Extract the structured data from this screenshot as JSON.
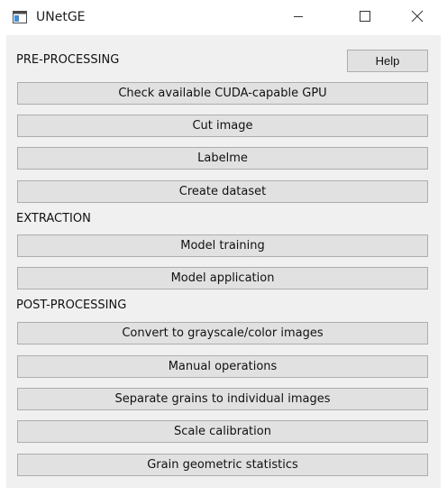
{
  "window": {
    "title": "UNetGE",
    "icons": {
      "app": "app-window-icon",
      "minimize": "minimize-icon",
      "maximize": "maximize-icon",
      "close": "close-icon"
    }
  },
  "sections": {
    "pre_processing": {
      "label": "PRE-PROCESSING",
      "help_label": "Help",
      "buttons": [
        "Check available CUDA-capable GPU",
        "Cut image",
        "Labelme",
        "Create dataset"
      ]
    },
    "extraction": {
      "label": "EXTRACTION",
      "buttons": [
        "Model training",
        "Model application"
      ]
    },
    "post_processing": {
      "label": "POST-PROCESSING",
      "buttons": [
        "Convert to grayscale/color images",
        "Manual operations",
        "Separate grains to individual images",
        "Scale calibration",
        "Grain geometric statistics"
      ]
    }
  }
}
